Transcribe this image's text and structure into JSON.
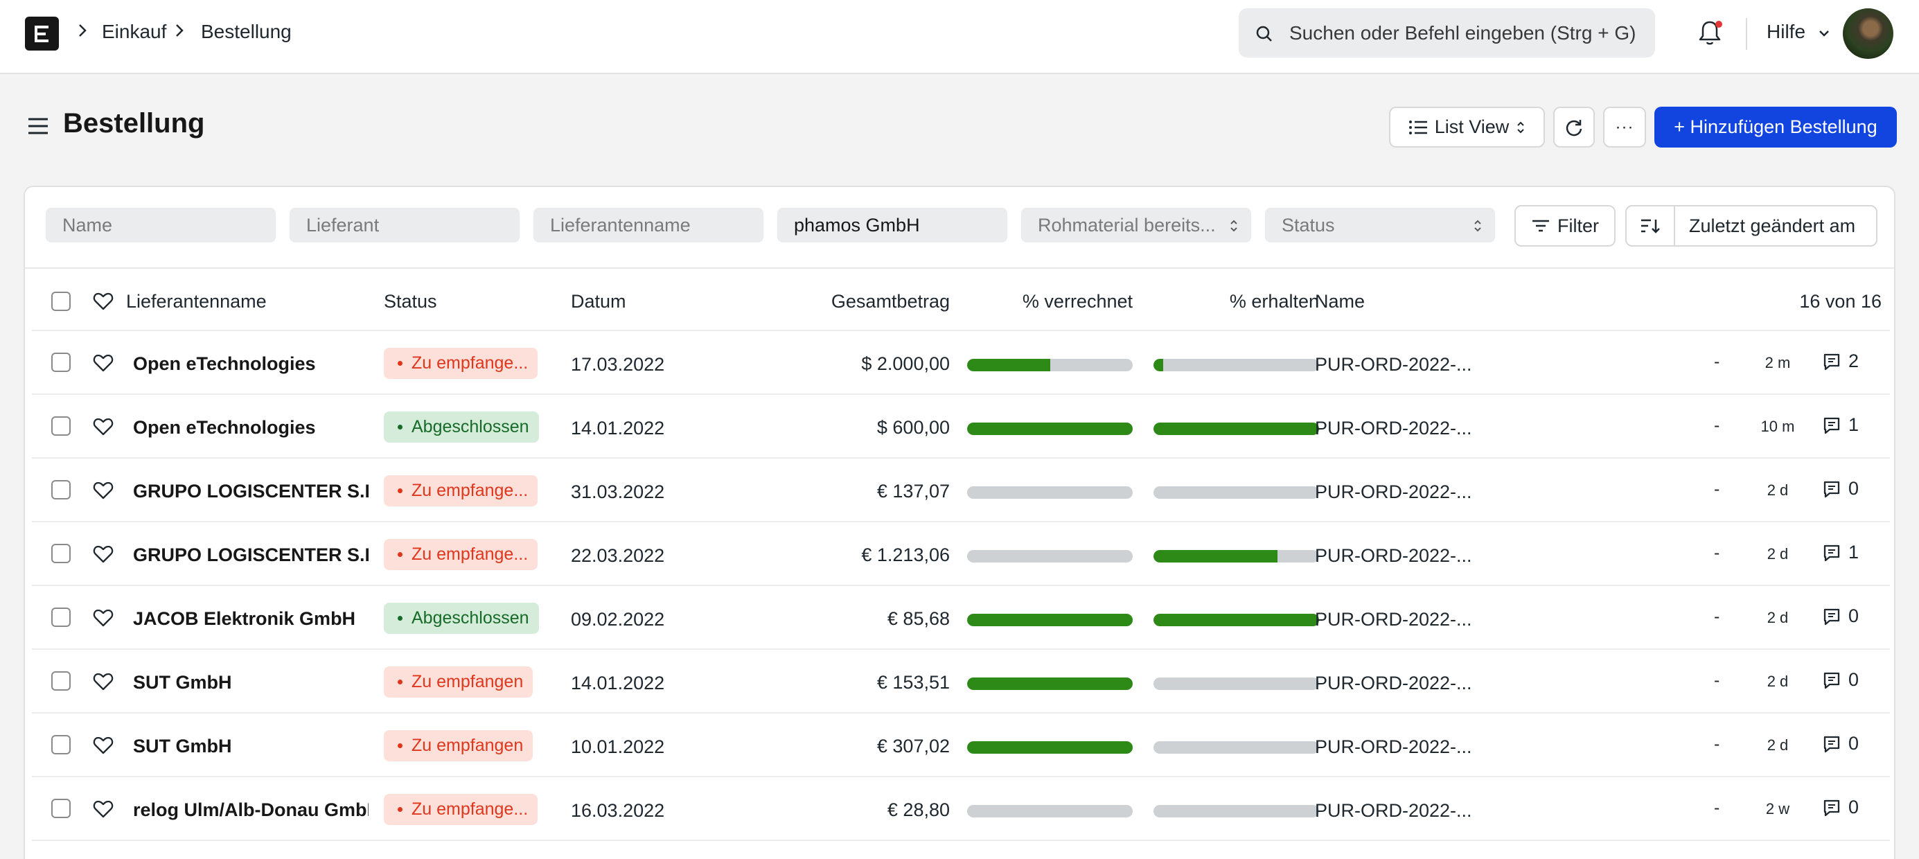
{
  "navbar": {
    "breadcrumbs": [
      "Einkauf",
      "Bestellung"
    ],
    "search_placeholder": "Suchen oder Befehl eingeben (Strg + G)",
    "help_label": "Hilfe",
    "notification_dot_color": "#e03636"
  },
  "header": {
    "title": "Bestellung",
    "view_label": "List View",
    "more_label": "···",
    "add_label": "+ Hinzufügen Bestellung"
  },
  "filters": {
    "name_placeholder": "Name",
    "supplier_placeholder": "Lieferant",
    "supplier_name_placeholder": "Lieferantenname",
    "supplier_name_value": "phamos GmbH",
    "raw_material_label": "Rohmaterial bereits...",
    "status_label": "Status",
    "filter_label": "Filter",
    "sort_label": "Zuletzt geändert am"
  },
  "table": {
    "columns": {
      "supplier_name": "Lieferantenname",
      "status": "Status",
      "date": "Datum",
      "total": "Gesamtbetrag",
      "billed": "% verrechnet",
      "received": "% erhalten",
      "name": "Name"
    },
    "count": "16 von 16",
    "rows": [
      {
        "supplier": "Open eTechnologies",
        "status": "Zu empfange...",
        "status_color": "red",
        "date": "17.03.2022",
        "amount": "$ 2.000,00",
        "billed": 0.5,
        "received": 0.06,
        "doc": "PUR-ORD-2022-...",
        "dash": "-",
        "time": "2 m",
        "comments": "2"
      },
      {
        "supplier": "Open eTechnologies",
        "status": "Abgeschlossen",
        "status_color": "green",
        "date": "14.01.2022",
        "amount": "$ 600,00",
        "billed": 1.0,
        "received": 1.0,
        "doc": "PUR-ORD-2022-...",
        "dash": "-",
        "time": "10 m",
        "comments": "1"
      },
      {
        "supplier": "GRUPO LOGISCENTER S.L",
        "status": "Zu empfange...",
        "status_color": "red",
        "date": "31.03.2022",
        "amount": "€ 137,07",
        "billed": 0.0,
        "received": 0.0,
        "doc": "PUR-ORD-2022-...",
        "dash": "-",
        "time": "2 d",
        "comments": "0"
      },
      {
        "supplier": "GRUPO LOGISCENTER S.L",
        "status": "Zu empfange...",
        "status_color": "red",
        "date": "22.03.2022",
        "amount": "€ 1.213,06",
        "billed": 0.0,
        "received": 0.75,
        "doc": "PUR-ORD-2022-...",
        "dash": "-",
        "time": "2 d",
        "comments": "1"
      },
      {
        "supplier": "JACOB Elektronik GmbH",
        "status": "Abgeschlossen",
        "status_color": "green",
        "date": "09.02.2022",
        "amount": "€ 85,68",
        "billed": 1.0,
        "received": 1.0,
        "doc": "PUR-ORD-2022-...",
        "dash": "-",
        "time": "2 d",
        "comments": "0"
      },
      {
        "supplier": "SUT GmbH",
        "status": "Zu empfangen",
        "status_color": "red",
        "date": "14.01.2022",
        "amount": "€ 153,51",
        "billed": 1.0,
        "received": 0.0,
        "doc": "PUR-ORD-2022-...",
        "dash": "-",
        "time": "2 d",
        "comments": "0"
      },
      {
        "supplier": "SUT GmbH",
        "status": "Zu empfangen",
        "status_color": "red",
        "date": "10.01.2022",
        "amount": "€ 307,02",
        "billed": 1.0,
        "received": 0.0,
        "doc": "PUR-ORD-2022-...",
        "dash": "-",
        "time": "2 d",
        "comments": "0"
      },
      {
        "supplier": "relog Ulm/Alb-Donau GmbH",
        "status": "Zu empfange...",
        "status_color": "red",
        "date": "16.03.2022",
        "amount": "€ 28,80",
        "billed": 0.0,
        "received": 0.0,
        "doc": "PUR-ORD-2022-...",
        "dash": "-",
        "time": "2 w",
        "comments": "0"
      }
    ]
  },
  "colors": {
    "primary": "#1244e0",
    "progress_fill": "#2e8a17",
    "progress_track": "#cdd1d4",
    "badge_red_bg": "#fde0d9",
    "badge_red_text": "#e0361c",
    "badge_green_bg": "#d4ecd9",
    "badge_green_text": "#166b28"
  }
}
